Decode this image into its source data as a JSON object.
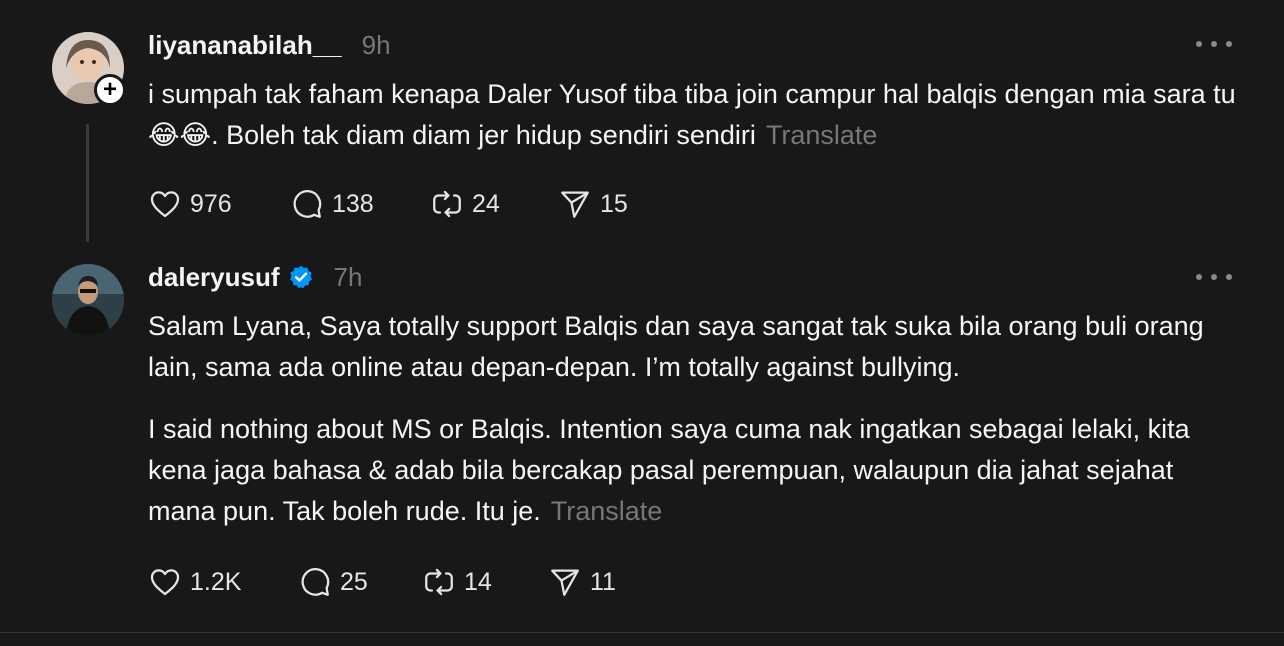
{
  "posts": [
    {
      "username": "liyananabilah__",
      "time": "9h",
      "text_pre": "i sumpah tak faham kenapa Daler Yusof tiba tiba join campur hal balqis dengan mia sara tu ",
      "emoji": "😂😂",
      "text_post": ". Boleh tak diam diam jer hidup sendiri sendiri",
      "translate": "Translate",
      "likes": "976",
      "replies": "138",
      "reposts": "24",
      "shares": "15"
    },
    {
      "username": "daleryusuf",
      "time": "7h",
      "paragraph1": "Salam Lyana, Saya totally support Balqis dan saya sangat tak suka bila orang buli orang lain, sama ada online atau depan-depan. I’m totally against bullying.",
      "paragraph2": "I said nothing about MS or Balqis. Intention saya cuma nak ingatkan sebagai lelaki, kita kena jaga bahasa & adab bila bercakap pasal perempuan, walaupun dia jahat sejahat mana pun. Tak boleh rude. Itu je.",
      "translate": "Translate",
      "likes": "1.2K",
      "replies": "25",
      "reposts": "14",
      "shares": "11"
    }
  ],
  "icons": {
    "like": "heart-icon",
    "reply": "comment-icon",
    "repost": "repost-icon",
    "share": "send-icon",
    "more": "more-icon",
    "verified": "verified-badge-icon",
    "follow": "plus-icon"
  },
  "colors": {
    "background": "#181818",
    "text": "#f3f5f7",
    "muted": "#777777",
    "verified": "#0095f6"
  }
}
